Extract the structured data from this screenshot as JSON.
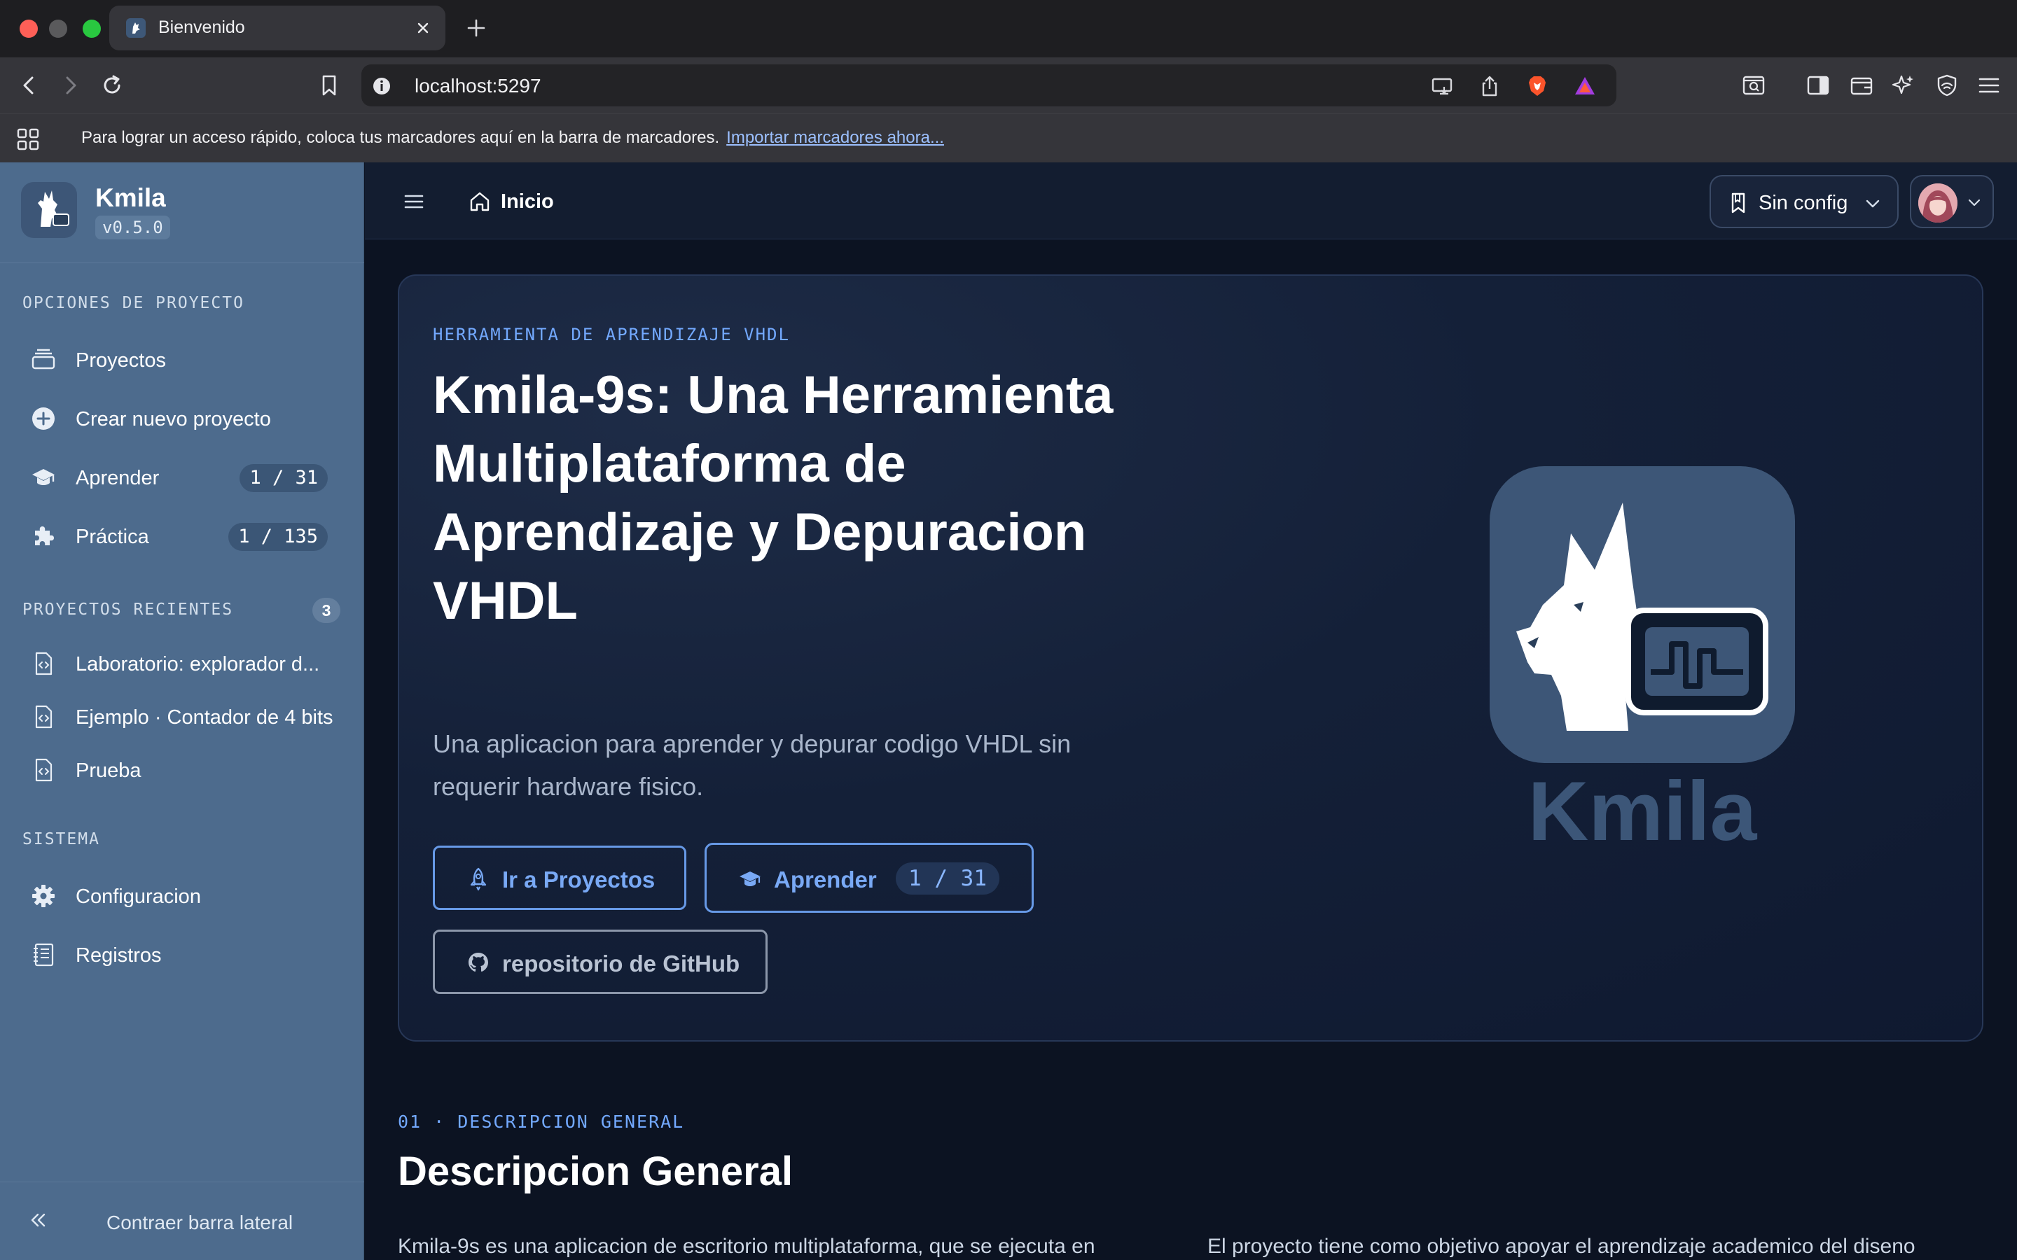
{
  "browser": {
    "tab_title": "Bienvenido",
    "url": "localhost:5297",
    "bookmarks_hint": "Para lograr un acceso rápido, coloca tus marcadores aquí en la barra de marcadores.",
    "bookmarks_import": "Importar marcadores ahora..."
  },
  "sidebar": {
    "brand_name": "Kmila",
    "version": "v0.5.0",
    "section_project": "OPCIONES DE PROYECTO",
    "items": [
      {
        "label": "Proyectos",
        "icon": "stack-icon"
      },
      {
        "label": "Crear nuevo proyecto",
        "icon": "plus-circle-icon"
      },
      {
        "label": "Aprender",
        "icon": "graduation-cap-icon",
        "badge": "1 / 31"
      },
      {
        "label": "Práctica",
        "icon": "puzzle-icon",
        "badge": "1 / 135"
      }
    ],
    "section_recent": "PROYECTOS RECIENTES",
    "recent_count": "3",
    "recent": [
      {
        "label": "Laboratorio: explorador d..."
      },
      {
        "label": "Ejemplo · Contador de 4 bits"
      },
      {
        "label": "Prueba"
      }
    ],
    "section_system": "SISTEMA",
    "system": [
      {
        "label": "Configuracion",
        "icon": "gear-icon"
      },
      {
        "label": "Registros",
        "icon": "notebook-icon"
      }
    ],
    "collapse_label": "Contraer barra lateral"
  },
  "header": {
    "breadcrumb": "Inicio",
    "config_label": "Sin config"
  },
  "hero": {
    "eyebrow": "HERRAMIENTA DE APRENDIZAJE VHDL",
    "title": "Kmila-9s: Una Herramienta Multiplataforma de Aprendizaje y Depuracion VHDL",
    "subtitle": "Una aplicacion para aprender y depurar codigo VHDL sin requerir hardware fisico.",
    "btn_projects": "Ir a Proyectos",
    "btn_learn": "Aprender",
    "btn_learn_badge": "1 / 31",
    "btn_github": "repositorio de GitHub",
    "logo_text": "Kmila"
  },
  "overview": {
    "eyebrow": "01 · DESCRIPCION GENERAL",
    "title": "Descripcion General",
    "left_text": "Kmila-9s es una aplicacion de escritorio multiplataforma, que se ejecuta en",
    "right_text": "El proyecto tiene como objetivo apoyar el aprendizaje academico del diseno"
  },
  "colors": {
    "sidebar_bg": "#4d6b8d",
    "main_bg": "#0c1322",
    "accent": "#73a9ff",
    "logo_tile": "#3d5677"
  }
}
